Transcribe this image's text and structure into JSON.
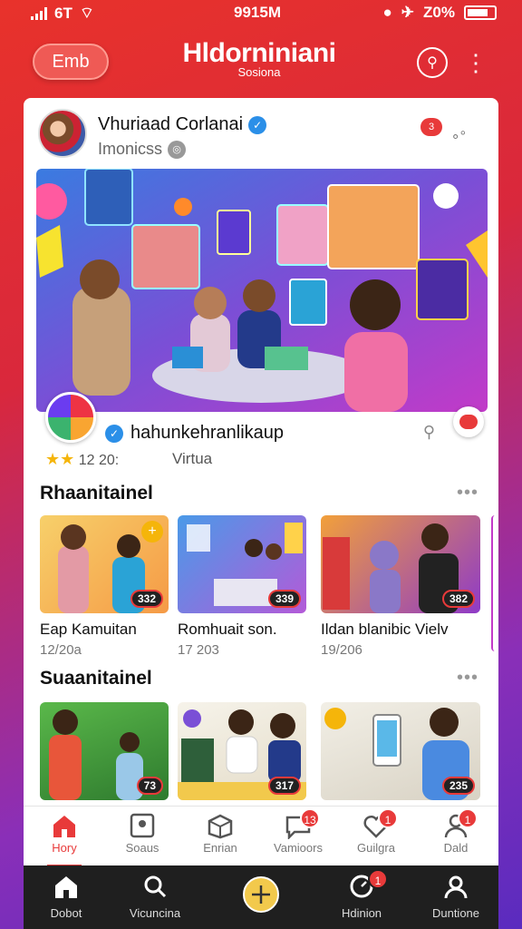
{
  "status": {
    "carrier": "6T",
    "time": "9915M",
    "battery": "Z0%"
  },
  "header": {
    "left_button": "Emb",
    "brand_title": "Hldorniniani",
    "brand_subtitle": "Sosiona"
  },
  "post": {
    "author": "Vhuriaad Corlanai",
    "subtitle": "Imonicss",
    "head_badge": "3",
    "app_name": "hahunkehranlikaup",
    "rating_text": "12 20:",
    "rating_stars": 2,
    "tag": "Virtua"
  },
  "sections": [
    {
      "title": "Rhaanitainel",
      "items": [
        {
          "title": "Eap Kamuitan",
          "meta": "12/20a",
          "count": "332"
        },
        {
          "title": "Romhuait son.",
          "meta": "17 203",
          "count": "339"
        },
        {
          "title": "Ildan blanibic Vielv",
          "meta": "19/206",
          "count": "382"
        }
      ]
    },
    {
      "title": "Suaanitainel",
      "items": [
        {
          "title": "",
          "meta": "",
          "count": "73"
        },
        {
          "title": "",
          "meta": "",
          "count": "317"
        },
        {
          "title": "",
          "meta": "",
          "count": "235"
        }
      ]
    }
  ],
  "tabs": [
    {
      "label": "Hory",
      "badge": ""
    },
    {
      "label": "Soaus",
      "badge": ""
    },
    {
      "label": "Enrian",
      "badge": ""
    },
    {
      "label": "Vamioors",
      "badge": "13"
    },
    {
      "label": "Guilgra",
      "badge": "1"
    },
    {
      "label": "Dald",
      "badge": "1"
    }
  ],
  "bottom_nav": [
    {
      "label": "Dobot"
    },
    {
      "label": "Vicuncina"
    },
    {
      "label": "Hdinion",
      "badge": "1"
    },
    {
      "label": "Duntione"
    }
  ],
  "colors": {
    "accent": "#e83a3a",
    "gold": "#f5b50a",
    "verified": "#2b8fe8"
  }
}
